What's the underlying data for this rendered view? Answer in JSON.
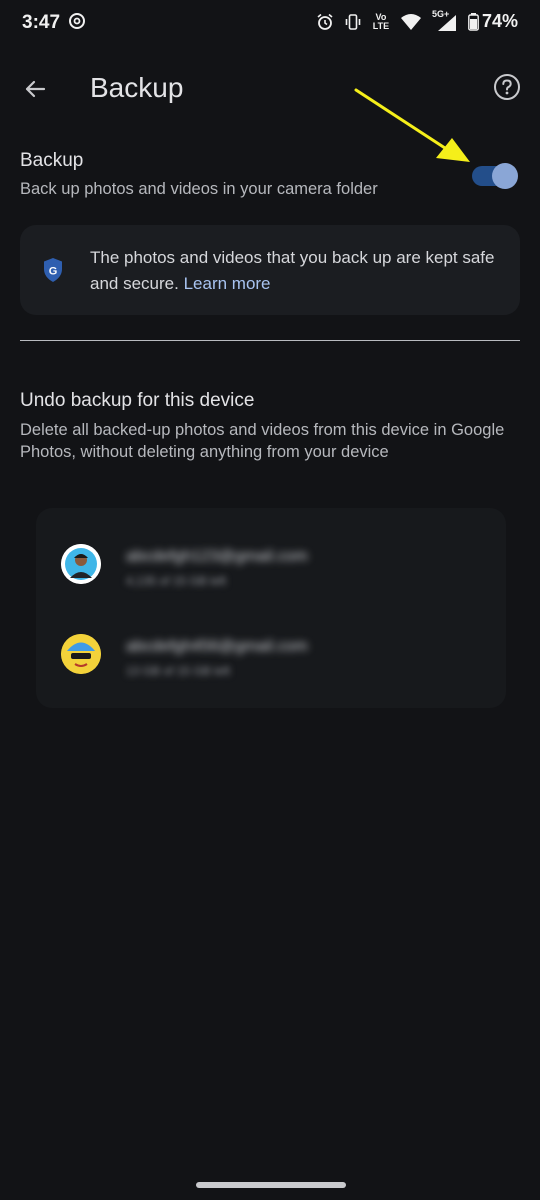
{
  "status_bar": {
    "time": "3:47",
    "battery": "74%",
    "network": "5G+",
    "volte": "Vo LTE"
  },
  "app_bar": {
    "title": "Backup"
  },
  "backup_setting": {
    "title": "Backup",
    "subtitle": "Back up photos and videos in your camera folder",
    "enabled": true
  },
  "info_card": {
    "text": "The photos and videos that you back up are kept safe and secure.",
    "link": "Learn more"
  },
  "undo_section": {
    "title": "Undo backup for this device",
    "description": "Delete all backed-up photos and videos from this device in Google Photos, without deleting anything from your device"
  },
  "accounts": [
    {
      "email": "abcdefgh123@gmail.com",
      "meta": "4,135 of 15 GB left"
    },
    {
      "email": "abcdefgh456@gmail.com",
      "meta": "13 GB of 15 GB left"
    }
  ],
  "colors": {
    "background": "#121316",
    "toggle_track": "#234e8a",
    "toggle_thumb": "#8aa6d6",
    "link": "#a8c3f0",
    "annotation_arrow": "#f5ef1a"
  }
}
